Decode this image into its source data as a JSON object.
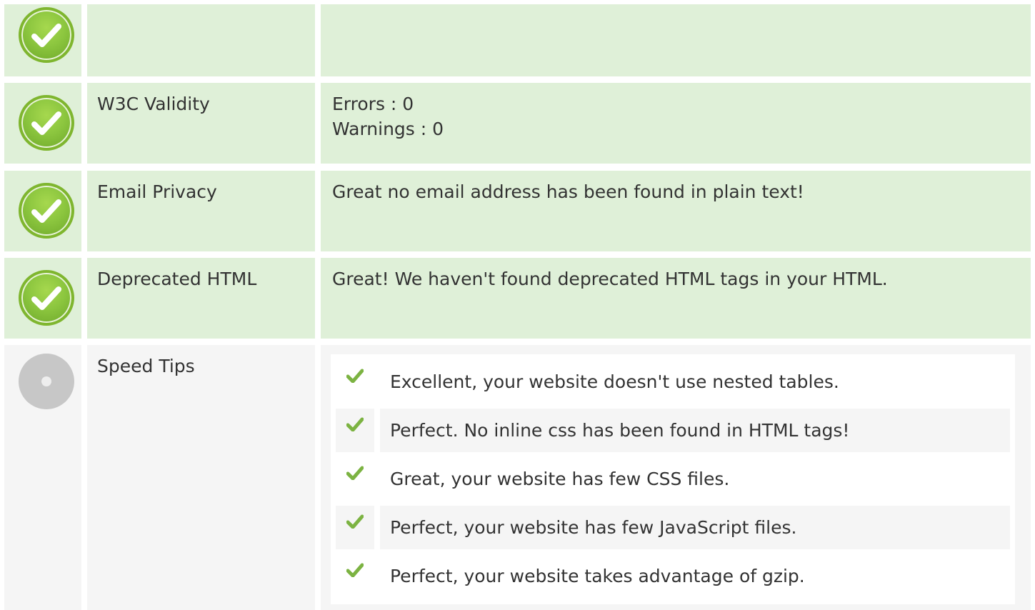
{
  "colors": {
    "pass_bg": "#dff0d8",
    "neutral_bg": "#f5f5f5",
    "pass_icon": "#8cc63f",
    "pending_icon": "#c7c7c7",
    "tick": "#7cb342"
  },
  "rows": [
    {
      "status": "pass",
      "label": "",
      "lines": []
    },
    {
      "status": "pass",
      "label": "W3C Validity",
      "lines": [
        "Errors : 0",
        "Warnings : 0"
      ]
    },
    {
      "status": "pass",
      "label": "Email Privacy",
      "lines": [
        "Great no email address has been found in plain text!"
      ]
    },
    {
      "status": "pass",
      "label": "Deprecated HTML",
      "lines": [
        "Great! We haven't found deprecated HTML tags in your HTML."
      ]
    }
  ],
  "speed_tips": {
    "status": "pending",
    "label": "Speed Tips",
    "items": [
      {
        "icon": "check-icon",
        "text": "Excellent, your website doesn't use nested tables."
      },
      {
        "icon": "check-icon",
        "text": "Perfect. No inline css has been found in HTML tags!"
      },
      {
        "icon": "check-icon",
        "text": "Great, your website has few CSS files."
      },
      {
        "icon": "check-icon",
        "text": "Perfect, your website has few JavaScript files."
      },
      {
        "icon": "check-icon",
        "text": "Perfect, your website takes advantage of gzip."
      }
    ]
  }
}
